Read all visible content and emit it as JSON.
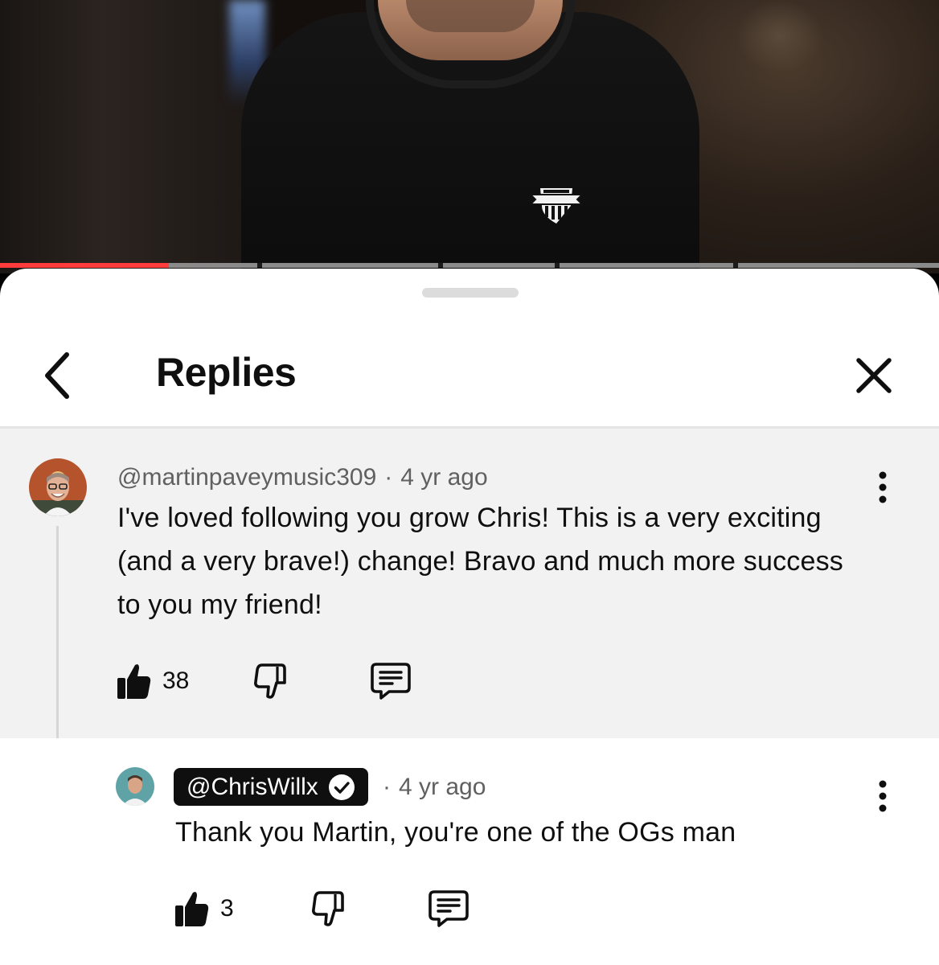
{
  "sheet": {
    "title": "Replies",
    "back_icon": "chevron-left-icon",
    "close_icon": "close-icon"
  },
  "video": {
    "progress_played_fraction": 0.18
  },
  "comment": {
    "author": "@martinpaveymusic309",
    "time": "4 yr ago",
    "text": "I've loved following you grow Chris! This is a very exciting (and a very brave!) change! Bravo and much more success to you my friend!",
    "like_count": "38"
  },
  "reply": {
    "author": "@ChrisWillx",
    "verified": true,
    "time": "4 yr ago",
    "text": "Thank you Martin, you're one of the OGs man",
    "like_count": "3"
  },
  "separator": "·",
  "colors": {
    "progress_played": "#ff3b3b",
    "highlight_bg": "#f2f2f2",
    "author_chip_bg": "#0f0f0f",
    "meta_text": "#606060"
  }
}
